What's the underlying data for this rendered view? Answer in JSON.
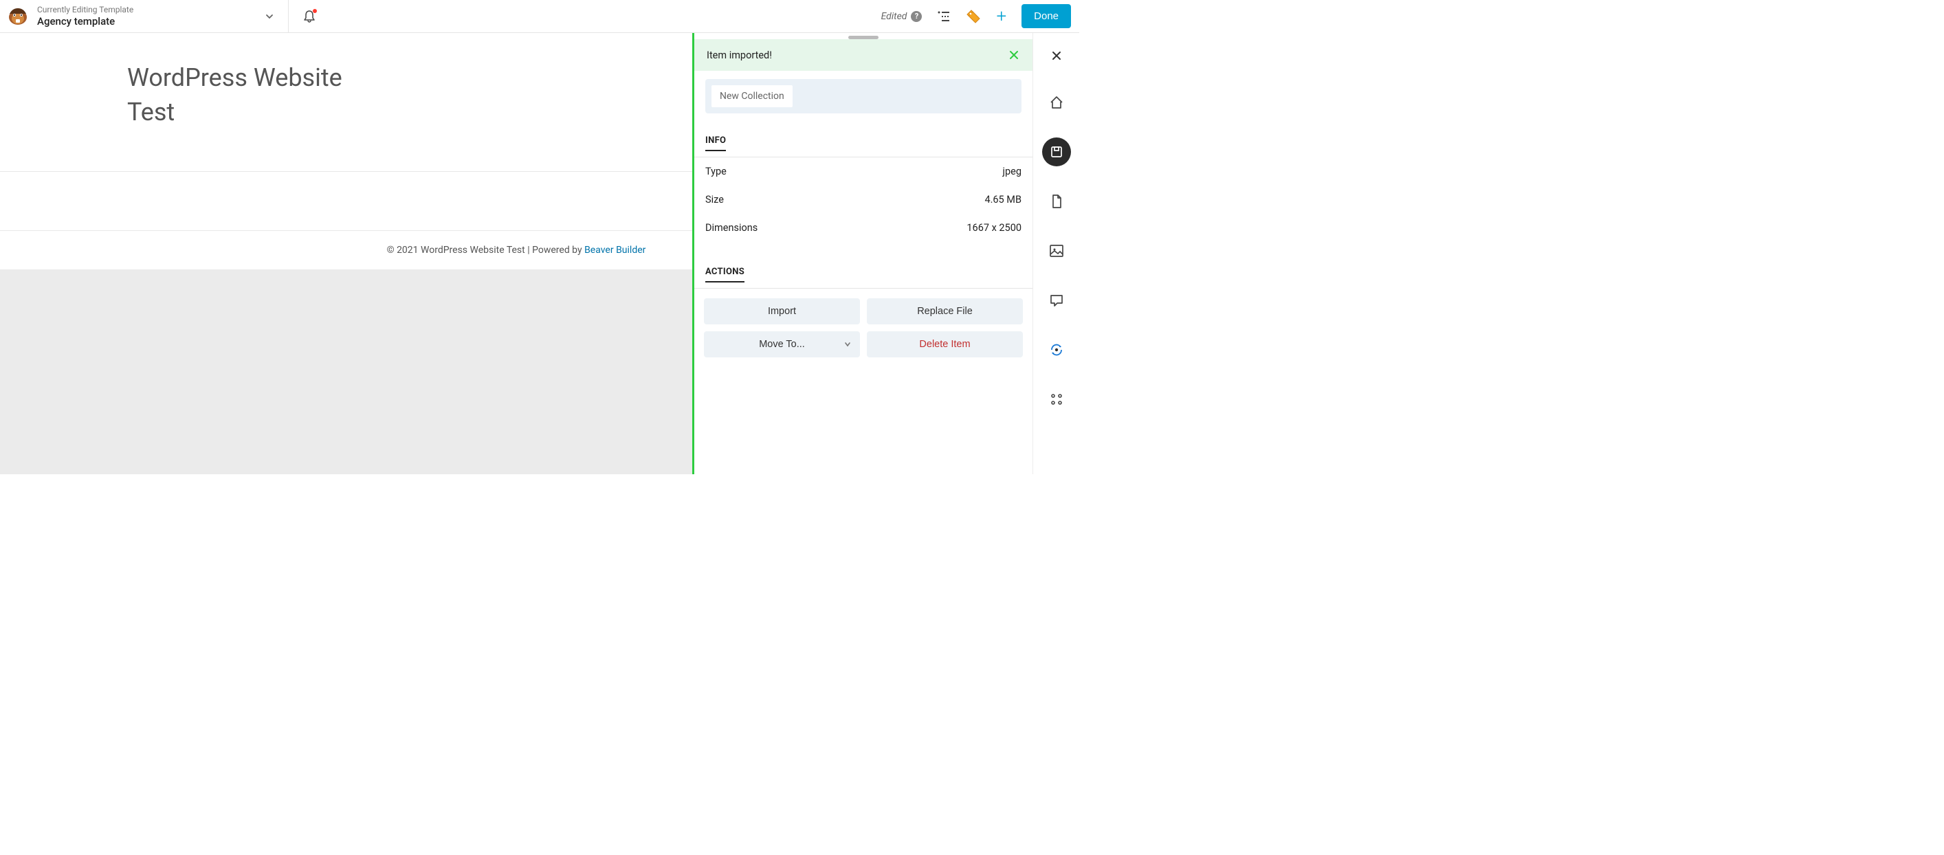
{
  "topbar": {
    "editing_label": "Currently Editing Template",
    "template_name": "Agency template",
    "edited_label": "Edited",
    "done_label": "Done"
  },
  "page": {
    "heading_line1": "WordPress Website",
    "heading_line2": "Test",
    "footer_prefix": "© 2021 WordPress Website Test | Powered by ",
    "footer_link": "Beaver Builder"
  },
  "panel": {
    "success_message": "Item imported!",
    "collection_chip": "New Collection",
    "info_heading": "INFO",
    "actions_heading": "ACTIONS",
    "info": [
      {
        "label": "Type",
        "value": "jpeg"
      },
      {
        "label": "Size",
        "value": "4.65 MB"
      },
      {
        "label": "Dimensions",
        "value": "1667 x 2500"
      }
    ],
    "actions": {
      "import": "Import",
      "replace": "Replace File",
      "move": "Move To...",
      "delete": "Delete Item"
    }
  }
}
